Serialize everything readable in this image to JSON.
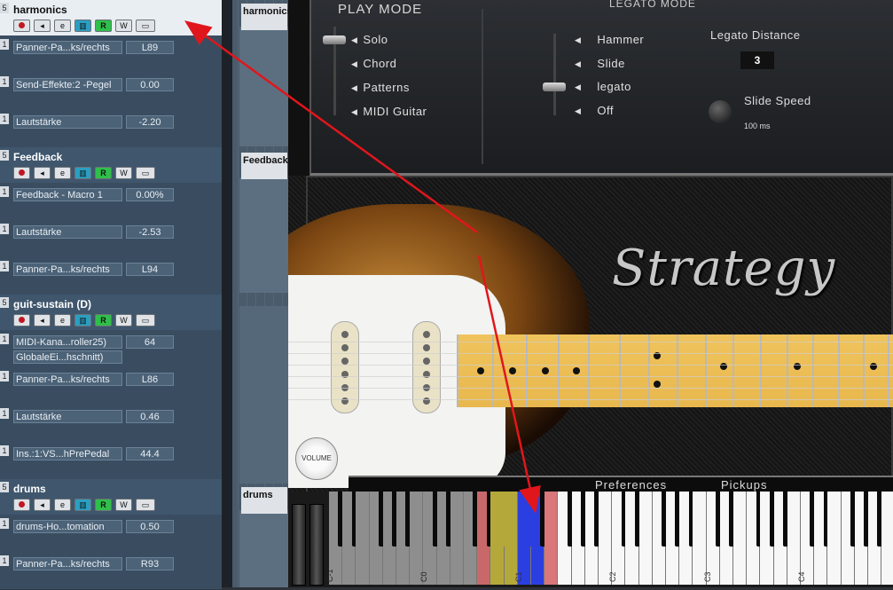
{
  "tracks": [
    {
      "name": "harmonics",
      "selected": true,
      "buttons": [
        "",
        "",
        "e",
        "",
        "R",
        "W",
        ""
      ],
      "automation": [
        {
          "param": "Panner-Pa...ks/rechts",
          "value": "L89"
        },
        {
          "param": "Send-Effekte:2 -Pegel",
          "value": "0.00"
        },
        {
          "param": "Lautstärke",
          "value": "-2.20"
        }
      ]
    },
    {
      "name": "Feedback",
      "selected": false,
      "buttons": [
        "",
        "",
        "e",
        "",
        "R",
        "W",
        ""
      ],
      "automation": [
        {
          "param": "Feedback - Macro 1",
          "value": "0.00%"
        },
        {
          "param": "Lautstärke",
          "value": "-2.53"
        },
        {
          "param": "Panner-Pa...ks/rechts",
          "value": "L94"
        }
      ]
    },
    {
      "name": "guit-sustain (D)",
      "selected": false,
      "buttons": [
        "",
        "",
        "e",
        "",
        "R",
        "W",
        ""
      ],
      "automation": [
        {
          "param": "MIDI-Kana...roller25)",
          "value": "64",
          "param2": "GlobaleEi...hschnitt)"
        },
        {
          "param": "Panner-Pa...ks/rechts",
          "value": "L86"
        },
        {
          "param": "Lautstärke",
          "value": "0.46"
        },
        {
          "param": "Ins.:1:VS...hPrePedal",
          "value": "44.4"
        }
      ]
    },
    {
      "name": "drums",
      "selected": false,
      "buttons": [
        "",
        "",
        "e",
        "",
        "R",
        "W",
        ""
      ],
      "automation": [
        {
          "param": "drums-Ho...tomation",
          "value": "0.50"
        },
        {
          "param": "Panner-Pa...ks/rechts",
          "value": "R93"
        }
      ]
    }
  ],
  "lane_numbers": {
    "track": "5",
    "auto": "1"
  },
  "clips": {
    "harmonics": "harmonics",
    "feedback": "Feedback",
    "drums": "drums"
  },
  "plugin": {
    "play_mode_title": "PLAY MODE",
    "play_modes": [
      "Solo",
      "Chord",
      "Patterns",
      "MIDI Guitar"
    ],
    "legato_mode_title": "LEGATO MODE",
    "legato_modes": [
      "Hammer",
      "Slide",
      "legato",
      "Off"
    ],
    "legato_distance_label": "Legato Distance",
    "legato_distance_value": "3",
    "slide_speed_label": "Slide Speed",
    "slide_speed_value": "100 ms",
    "brand": "Strategy",
    "volume_knob_label": "VOLUME",
    "tabs": [
      "Preferences",
      "Pickups"
    ],
    "octave_labels": [
      "C-1",
      "C0",
      "C1",
      "C2",
      "C3",
      "C4",
      "C5"
    ],
    "colors": {
      "key_red": "#c9686a",
      "key_yellow": "#b5a83a",
      "key_blue": "#2b3fe0",
      "key_lightred": "#d9777a",
      "arrow": "#e0161c"
    }
  }
}
